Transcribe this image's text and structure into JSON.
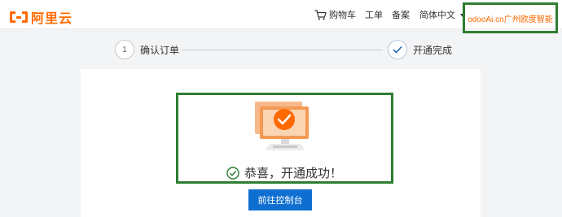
{
  "header": {
    "logo_text": "阿里云",
    "nav": {
      "cart_label": "购物车",
      "ticket_label": "工单",
      "record_label": "备案",
      "language_label": "简体中文"
    },
    "user_account": "odooAi.cn广州欧度智能"
  },
  "steps": [
    {
      "number": "1",
      "label": "确认订单"
    },
    {
      "label": "开通完成"
    }
  ],
  "result": {
    "message": "恭喜，开通成功！",
    "button_label": "前往控制台"
  },
  "colors": {
    "brand": "#ff6a00",
    "primary_button": "#0f6fd1",
    "success": "#2e7d32",
    "highlight_border": "#2e7d32"
  },
  "icons": [
    "aliyun-logo-icon",
    "cart-icon",
    "caret-down-icon",
    "check-circle-icon",
    "computer-check-illustration"
  ]
}
